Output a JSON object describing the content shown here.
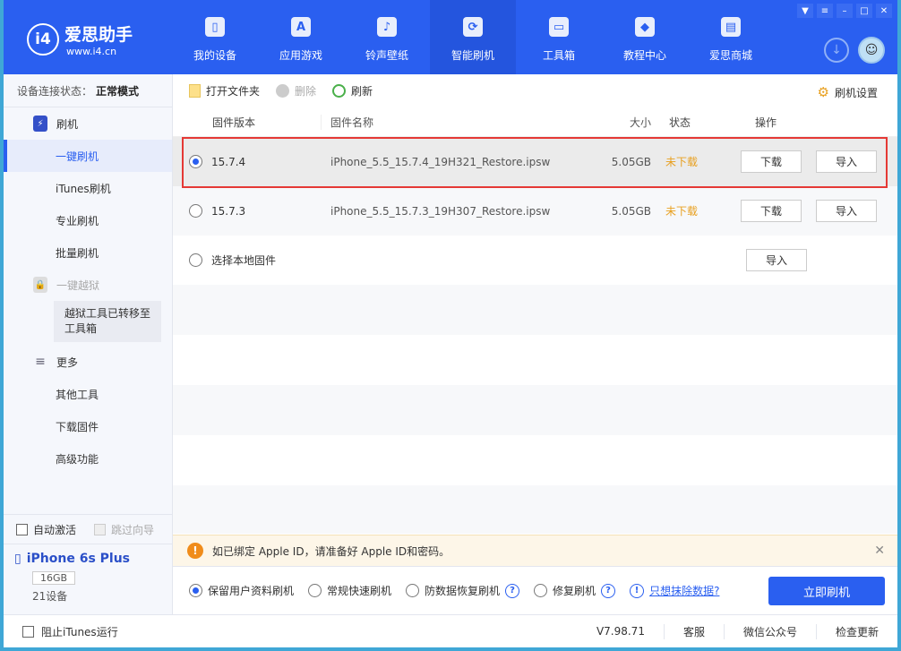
{
  "app": {
    "logo_name": "爱思助手",
    "logo_url": "www.i4.cn"
  },
  "nav": [
    {
      "label": "我的设备"
    },
    {
      "label": "应用游戏"
    },
    {
      "label": "铃声壁纸"
    },
    {
      "label": "智能刷机"
    },
    {
      "label": "工具箱"
    },
    {
      "label": "教程中心"
    },
    {
      "label": "爱思商城"
    }
  ],
  "sidebar": {
    "status_label": "设备连接状态：",
    "status_value": "正常模式",
    "flash_group": "刷机",
    "items": [
      {
        "label": "一键刷机"
      },
      {
        "label": "iTunes刷机"
      },
      {
        "label": "专业刷机"
      },
      {
        "label": "批量刷机"
      }
    ],
    "jailbreak": "一键越狱",
    "jailbreak_tip": "越狱工具已转移至工具箱",
    "more_group": "更多",
    "more_items": [
      {
        "label": "其他工具"
      },
      {
        "label": "下载固件"
      },
      {
        "label": "高级功能"
      }
    ],
    "auto_activate": "自动激活",
    "skip_guide": "跳过向导",
    "device_name": "iPhone 6s Plus",
    "device_storage": "16GB",
    "device_count": "21设备"
  },
  "toolbar": {
    "open_folder": "打开文件夹",
    "delete": "删除",
    "refresh": "刷新",
    "settings": "刷机设置"
  },
  "table": {
    "headers": {
      "version": "固件版本",
      "name": "固件名称",
      "size": "大小",
      "status": "状态",
      "action": "操作"
    },
    "rows": [
      {
        "version": "15.7.4",
        "name": "iPhone_5.5_15.7.4_19H321_Restore.ipsw",
        "size": "5.05GB",
        "status": "未下载",
        "download": "下载",
        "import": "导入"
      },
      {
        "version": "15.7.3",
        "name": "iPhone_5.5_15.7.3_19H307_Restore.ipsw",
        "size": "5.05GB",
        "status": "未下载",
        "download": "下载",
        "import": "导入"
      }
    ],
    "local": {
      "label": "选择本地固件",
      "import": "导入"
    }
  },
  "notice": {
    "text": "如已绑定 Apple ID，请准备好 Apple ID和密码。"
  },
  "options": {
    "keep_data": "保留用户资料刷机",
    "quick": "常规快速刷机",
    "anti_loss": "防数据恢复刷机",
    "repair": "修复刷机",
    "erase_link": "只想抹除数据?",
    "flash_now": "立即刷机"
  },
  "footer": {
    "block_itunes": "阻止iTunes运行",
    "version": "V7.98.71",
    "support": "客服",
    "wechat": "微信公众号",
    "update": "检查更新"
  }
}
